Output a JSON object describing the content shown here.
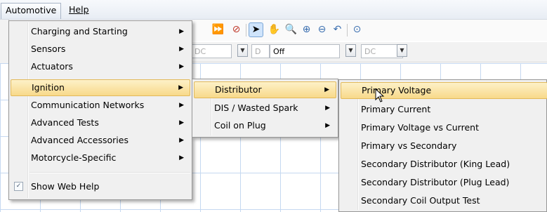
{
  "menubar": {
    "automotive": "Automotive",
    "help": "Help"
  },
  "settings": {
    "field1": "DC",
    "field2": "D",
    "field2_value": "Off",
    "field3": "DC"
  },
  "automotive_menu": {
    "items": [
      {
        "label": "Charging and Starting",
        "submenu": true
      },
      {
        "label": "Sensors",
        "submenu": true
      },
      {
        "label": "Actuators",
        "submenu": true
      },
      {
        "label": "Ignition",
        "submenu": true,
        "highlighted": true
      },
      {
        "label": "Communication Networks",
        "submenu": true
      },
      {
        "label": "Advanced Tests",
        "submenu": true
      },
      {
        "label": "Advanced Accessories",
        "submenu": true
      },
      {
        "label": "Motorcycle-Specific",
        "submenu": true
      }
    ],
    "show_web_help": "Show Web Help",
    "show_web_help_checked": true
  },
  "ignition_menu": {
    "items": [
      {
        "label": "Distributor",
        "submenu": true,
        "highlighted": true
      },
      {
        "label": "DIS / Wasted Spark",
        "submenu": true
      },
      {
        "label": "Coil on Plug",
        "submenu": true
      }
    ]
  },
  "distributor_menu": {
    "items": [
      {
        "label": "Primary Voltage",
        "highlighted": true
      },
      {
        "label": "Primary Current"
      },
      {
        "label": "Primary Voltage vs Current"
      },
      {
        "label": "Primary vs Secondary"
      },
      {
        "label": "Secondary Distributor (King Lead)"
      },
      {
        "label": "Secondary Distributor (Plug Lead)"
      },
      {
        "label": "Secondary Coil Output Test"
      }
    ]
  },
  "colors": {
    "highlight": "#f8d98a",
    "menu_bg": "#f0f0f0",
    "grid_line": "#bcd2ee"
  }
}
